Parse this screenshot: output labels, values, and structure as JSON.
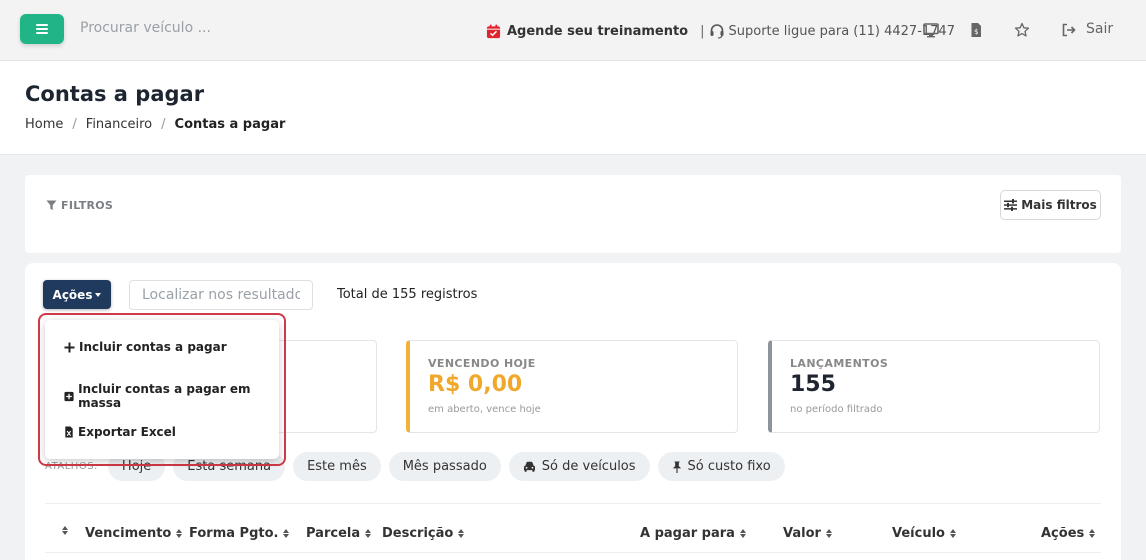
{
  "topbar": {
    "search_placeholder": "Procurar veículo ...",
    "training_label": "Agende seu treinamento",
    "separator": "|",
    "support_label": "Suporte ligue para (11) 4427-1747",
    "exit_label": "Sair",
    "menu_color": "#20b486"
  },
  "header": {
    "title": "Contas a pagar",
    "breadcrumbs": [
      "Home",
      "Financeiro",
      "Contas a pagar"
    ],
    "separator": "/"
  },
  "filters": {
    "label": "FILTROS",
    "more_filters_label": "Mais filtros"
  },
  "toolbar": {
    "actions_label": "Ações",
    "search_placeholder": "Localizar nos resultados",
    "total_text": "Total de 155 registros"
  },
  "stats": [
    {
      "label": "VENCENDO HOJE",
      "value": "R$ 0,00",
      "sub": "em aberto, vence hoje",
      "color": "#f0a82c"
    },
    {
      "label": "LANÇAMENTOS",
      "value": "155",
      "sub": "no período filtrado",
      "color": "#8e949b"
    }
  ],
  "shortcuts": {
    "label": "ATALHOS:",
    "chips": [
      "Hoje",
      "Esta semana",
      "Este mês",
      "Mês passado",
      "Só de veículos",
      "Só custo fixo"
    ]
  },
  "table": {
    "columns": [
      "Vencimento",
      "Forma Pgto.",
      "Parcela",
      "Descrição",
      "A pagar para",
      "Valor",
      "Veículo",
      "Ações"
    ]
  },
  "actions_menu": {
    "items": [
      "Incluir contas a pagar",
      "Incluir contas a pagar em massa",
      "Exportar Excel"
    ],
    "highlight_color": "#cf3a48"
  }
}
